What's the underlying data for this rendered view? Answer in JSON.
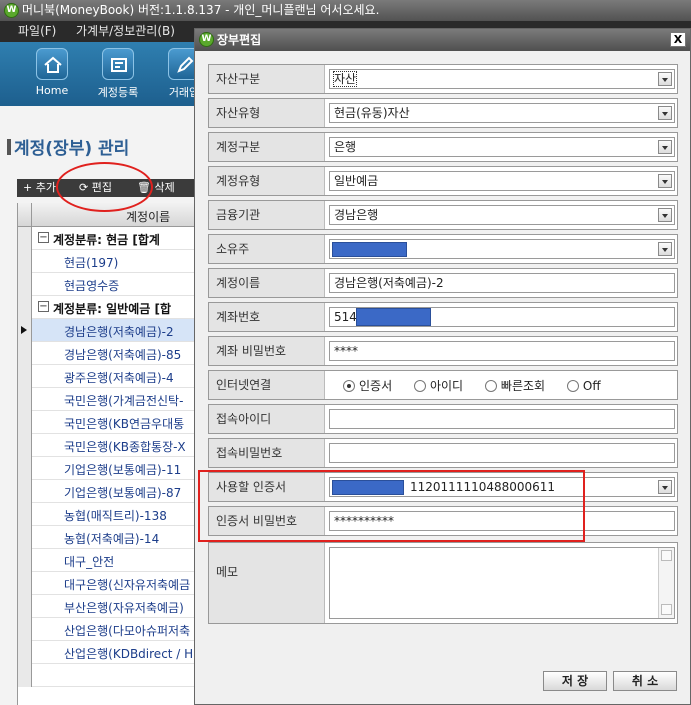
{
  "app": {
    "window_title": "머니북(MoneyBook) 버전:1.1.8.137 - 개인_머니플랜님 어서오세요.",
    "menu": [
      "파일(F)",
      "가계부/정보관리(B)"
    ]
  },
  "toolbar": {
    "buttons": [
      {
        "label": "Home",
        "icon": "home-icon"
      },
      {
        "label": "계정등록",
        "icon": "account-register-icon"
      },
      {
        "label": "거래입",
        "icon": "edit-icon"
      }
    ]
  },
  "left": {
    "page_title": "계정(장부) 관리",
    "list_toolbar": {
      "add": "+ 추가",
      "edit": "편집",
      "delete": "삭제"
    },
    "grid_header": "계정이름",
    "groups": [
      {
        "title": "계정분류: 현금   [합계",
        "items": [
          "현금(197)",
          "현금영수증"
        ]
      },
      {
        "title": "계정분류: 일반예금   [합",
        "items": [
          "경남은행(저축예금)-2",
          "경남은행(저축예금)-85",
          "광주은행(저축예금)-4",
          "국민은행(가계금전신탁-",
          "국민은행(KB연금우대통",
          "국민은행(KB종합통장-X",
          "기업은행(보통예금)-11",
          "기업은행(보통예금)-87",
          "농협(매직트리)-138",
          "농협(저축예금)-14",
          "대구_안전",
          "대구은행(신자유저축예금",
          "부산은행(자유저축예금)",
          "산업은행(다모아슈퍼저축",
          "산업은행(KDBdirect / H"
        ]
      }
    ],
    "selected_item": "경남은행(저축예금)-2"
  },
  "dialog": {
    "title": "장부편집",
    "close": "X",
    "fields": {
      "asset_class": {
        "label": "자산구분",
        "value": "자산"
      },
      "asset_type": {
        "label": "자산유형",
        "value": "현금(유동)자산"
      },
      "account_class": {
        "label": "계정구분",
        "value": "은행"
      },
      "account_type": {
        "label": "계정유형",
        "value": "일반예금"
      },
      "institution": {
        "label": "금융기관",
        "value": "경남은행"
      },
      "owner": {
        "label": "소유주",
        "value": ""
      },
      "account_name": {
        "label": "계정이름",
        "value": "경남은행(저축예금)-2"
      },
      "account_number": {
        "label": "계좌번호",
        "value": "514"
      },
      "account_password": {
        "label": "계좌 비밀번호",
        "value": "****"
      },
      "internet": {
        "label": "인터넷연결",
        "options": [
          "인증서",
          "아이디",
          "빠른조회",
          "Off"
        ],
        "selected": "인증서"
      },
      "login_id": {
        "label": "접속아이디",
        "value": ""
      },
      "login_password": {
        "label": "접속비밀번호",
        "value": ""
      },
      "certificate": {
        "label": "사용할 인증서",
        "value": "1120111110488000611"
      },
      "cert_password": {
        "label": "인증서 비밀번호",
        "value": "**********"
      },
      "memo": {
        "label": "메모",
        "value": ""
      }
    },
    "save": "저 장",
    "cancel": "취 소"
  },
  "colors": {
    "redaction": "#3b69c6",
    "highlight": "#e0211e",
    "toolbar": "#1d5f8e"
  }
}
